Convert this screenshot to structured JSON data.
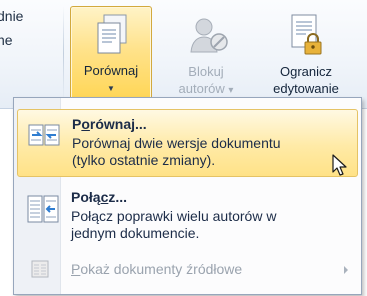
{
  "ribbon": {
    "cut_text_1": "dnie",
    "cut_text_2": "ne",
    "compare_button": {
      "label": "Porównaj",
      "arrow": "▼",
      "icon": "document-compare-icon"
    },
    "block_authors_button": {
      "line1": "Blokuj",
      "line2": "autorów",
      "arrow": "▾",
      "icon": "block-authors-icon",
      "disabled": true
    },
    "restrict_editing_button": {
      "line1": "Ogranicz",
      "line2": "edytowanie",
      "icon": "document-lock-icon"
    }
  },
  "menu": {
    "items": [
      {
        "title_prefix": "P",
        "title_underlined": "o",
        "title_rest": "równaj...",
        "desc_line1": "Porównaj dwie wersje dokumentu",
        "desc_line2": "(tylko ostatnie zmiany).",
        "icon": "compare-documents-icon",
        "highlighted": true
      },
      {
        "title_prefix": "Połą",
        "title_underlined": "c",
        "title_rest": "z...",
        "desc_line1": "Połącz poprawki wielu autorów w",
        "desc_line2": "jednym dokumencie.",
        "icon": "combine-documents-icon",
        "highlighted": false
      },
      {
        "title_prefix": "",
        "title_underlined": "P",
        "title_rest": "okaż dokumenty źródłowe",
        "icon": "source-documents-icon",
        "disabled": true,
        "has_submenu": true
      }
    ]
  },
  "colors": {
    "highlight": "#ffe287",
    "highlight_border": "#e5c365",
    "text": "#1c2c48",
    "disabled_text": "#9aa3ae"
  }
}
